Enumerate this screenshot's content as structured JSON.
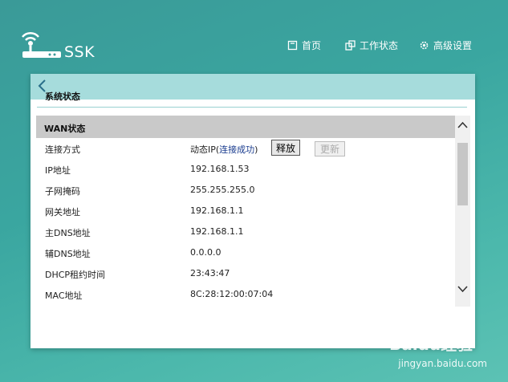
{
  "brand": "SSK",
  "nav": {
    "home": "首页",
    "work_status": "工作状态",
    "advanced": "高级设置"
  },
  "panel": {
    "title": "系统状态",
    "section_title": "WAN状态"
  },
  "wan": {
    "rows": [
      {
        "label": "连接方式",
        "value_prefix": "动态IP(",
        "value_link": "连接成功",
        "value_suffix": ")"
      },
      {
        "label": "IP地址",
        "value": "192.168.1.53"
      },
      {
        "label": "子网掩码",
        "value": "255.255.255.0"
      },
      {
        "label": "网关地址",
        "value": "192.168.1.1"
      },
      {
        "label": "主DNS地址",
        "value": "192.168.1.1"
      },
      {
        "label": "辅DNS地址",
        "value": "0.0.0.0"
      },
      {
        "label": "DHCP租约时间",
        "value": "23:43:47"
      },
      {
        "label": "MAC地址",
        "value": "8C:28:12:00:07:04"
      }
    ],
    "release_button": "释放",
    "renew_button": "更新"
  },
  "watermark": {
    "logo_text": "Baidu经验",
    "url": "jingyan.baidu.com"
  },
  "colors": {
    "panel_header": "#a6dcdc",
    "section_header": "#c9c9c9",
    "link": "#1a3c8f"
  }
}
